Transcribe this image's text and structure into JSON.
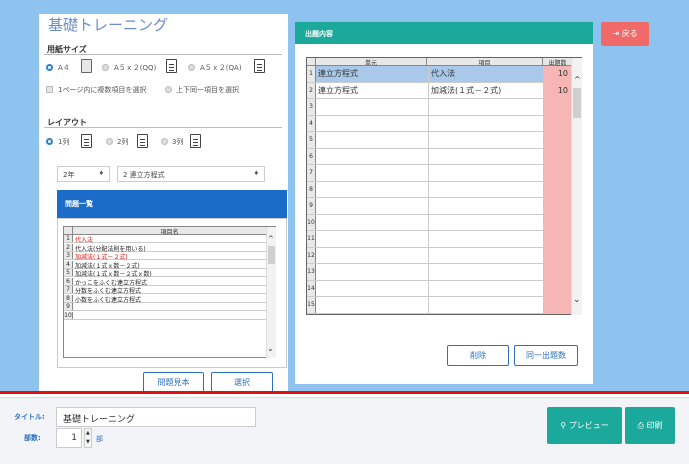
{
  "app": {
    "title": "基礎トレーニング"
  },
  "paper": {
    "label": "用紙サイズ",
    "options": [
      "A４",
      "A５ｘ２(QQ)",
      "A５ｘ２(QA)"
    ],
    "checkboxes": [
      "1ページ内に複数項目を選択",
      "上下同一項目を選択"
    ]
  },
  "layout": {
    "label": "レイアウト",
    "options": [
      "1列",
      "2列",
      "3列"
    ]
  },
  "filters": {
    "grade": "2年",
    "unit": "2 連立方程式"
  },
  "problem_list": {
    "title": "問題一覧",
    "col_header": "項目名",
    "rows": [
      {
        "n": "1",
        "name": "代入法",
        "color": "red"
      },
      {
        "n": "2",
        "name": "代入法(分配法則を用いる)",
        "color": "black"
      },
      {
        "n": "3",
        "name": "加減法(１式－２式)",
        "color": "red"
      },
      {
        "n": "4",
        "name": "加減法(１式ｘ数－２式)",
        "color": "black"
      },
      {
        "n": "5",
        "name": "加減法(１式ｘ数－２式ｘ数)",
        "color": "black"
      },
      {
        "n": "6",
        "name": "かっこをふくむ連立方程式",
        "color": "black"
      },
      {
        "n": "7",
        "name": "分数をふくむ連立方程式",
        "color": "black"
      },
      {
        "n": "8",
        "name": "小数をふくむ連立方程式",
        "color": "black"
      },
      {
        "n": "9",
        "name": "",
        "color": "black"
      },
      {
        "n": "10",
        "name": "",
        "color": "black"
      }
    ],
    "sample_btn": "問題見本",
    "select_btn": "選択"
  },
  "output": {
    "title": "出題内容",
    "headers": {
      "unit": "単元",
      "item": "項目",
      "count": "出題数"
    },
    "rows": [
      {
        "n": "1",
        "unit": "連立方程式",
        "item": "代入法",
        "count": "10"
      },
      {
        "n": "2",
        "unit": "連立方程式",
        "item": "加減法(１式－２式)",
        "count": "10"
      },
      {
        "n": "3",
        "unit": "",
        "item": "",
        "count": ""
      },
      {
        "n": "4",
        "unit": "",
        "item": "",
        "count": ""
      },
      {
        "n": "5",
        "unit": "",
        "item": "",
        "count": ""
      },
      {
        "n": "6",
        "unit": "",
        "item": "",
        "count": ""
      },
      {
        "n": "7",
        "unit": "",
        "item": "",
        "count": ""
      },
      {
        "n": "8",
        "unit": "",
        "item": "",
        "count": ""
      },
      {
        "n": "9",
        "unit": "",
        "item": "",
        "count": ""
      },
      {
        "n": "10",
        "unit": "",
        "item": "",
        "count": ""
      },
      {
        "n": "11",
        "unit": "",
        "item": "",
        "count": ""
      },
      {
        "n": "12",
        "unit": "",
        "item": "",
        "count": ""
      },
      {
        "n": "13",
        "unit": "",
        "item": "",
        "count": ""
      },
      {
        "n": "14",
        "unit": "",
        "item": "",
        "count": ""
      },
      {
        "n": "15",
        "unit": "",
        "item": "",
        "count": ""
      }
    ],
    "delete_btn": "削除",
    "same_btn": "同一出題数"
  },
  "back_btn": "戻る",
  "footer": {
    "title_label": "タイトル:",
    "title_value": "基礎トレーニング",
    "copies_label": "部数:",
    "copies_value": "1",
    "copies_unit": "部",
    "preview_btn": "プレビュー",
    "print_btn": "印刷"
  },
  "icons": [
    "back-icon",
    "search-icon",
    "print-icon",
    "document-icon",
    "chevron-down-icon",
    "spin-up-icon",
    "spin-down-icon"
  ],
  "colors": {
    "accent": "#1aa99b",
    "brand_blue": "#1a6cc8",
    "danger": "#f06a6a",
    "highlight": "#f7b6b6",
    "background": "#8fc3ef"
  }
}
